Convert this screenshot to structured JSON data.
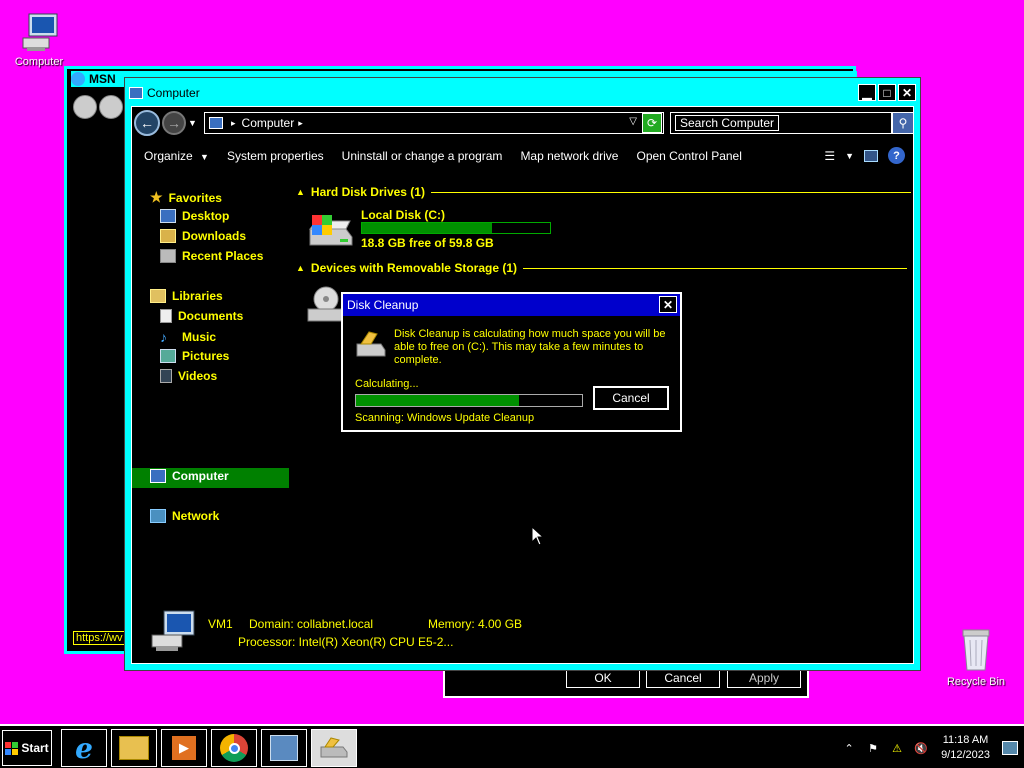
{
  "desktop": {
    "computer_icon_label": "Computer",
    "recycle_bin_label": "Recycle Bin"
  },
  "back_window": {
    "title": "MSN",
    "url_fragment": "https://wv"
  },
  "back_dialog": {
    "ok_label": "OK",
    "cancel_label": "Cancel",
    "apply_label": "Apply"
  },
  "explorer": {
    "title": "Computer",
    "address": "Computer",
    "search_placeholder": "Search Computer",
    "toolbar": {
      "organize": "Organize",
      "system_properties": "System properties",
      "uninstall": "Uninstall or change a program",
      "map_drive": "Map network drive",
      "control_panel": "Open Control Panel"
    },
    "sidebar": {
      "favorites": "Favorites",
      "desktop": "Desktop",
      "downloads": "Downloads",
      "recent": "Recent Places",
      "libraries": "Libraries",
      "documents": "Documents",
      "music": "Music",
      "pictures": "Pictures",
      "videos": "Videos",
      "computer": "Computer",
      "network": "Network"
    },
    "groups": {
      "hard_disks": "Hard Disk Drives (1)",
      "removable": "Devices with Removable Storage (1)"
    },
    "drive": {
      "name": "Local Disk (C:)",
      "free_text": "18.8 GB free of 59.8 GB",
      "used_fraction": 0.69
    },
    "details": {
      "name": "VM1",
      "domain": "Domain: collabnet.local",
      "memory": "Memory: 4.00 GB",
      "processor": "Processor: Intel(R) Xeon(R) CPU E5-2..."
    }
  },
  "cleanup": {
    "title": "Disk Cleanup",
    "message": "Disk Cleanup is calculating how much space you will be able to free on  (C:). This may take a few minutes to complete.",
    "status": "Calculating...",
    "progress": 0.72,
    "cancel_label": "Cancel",
    "scanning": "Scanning:  Windows Update Cleanup"
  },
  "taskbar": {
    "start_label": "Start",
    "time": "11:18 AM",
    "date": "9/12/2023"
  },
  "colors": {
    "desktop_bg": "#ff00ff",
    "window_frame": "#00ffff",
    "text_highlight": "#ffff00",
    "selection": "#008000",
    "dialog_title": "#0000cc"
  }
}
